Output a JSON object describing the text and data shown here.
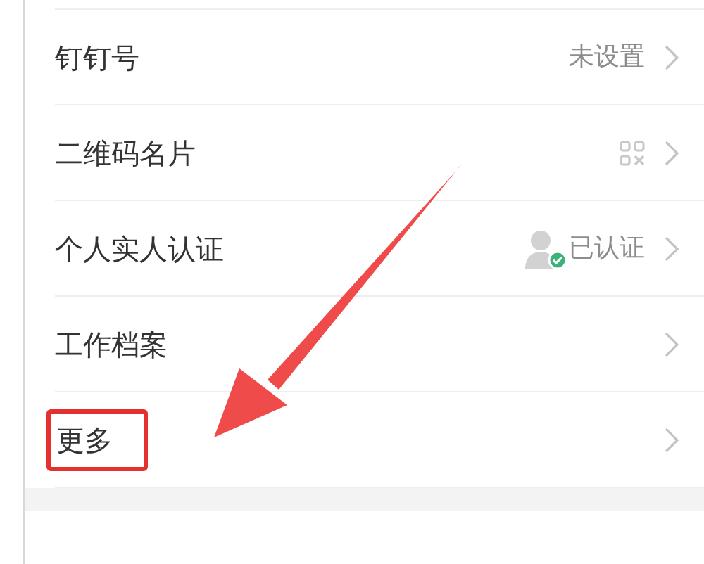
{
  "items": [
    {
      "label": "钉钉号",
      "kind": "text",
      "value": "未设置",
      "highlighted": false
    },
    {
      "label": "二维码名片",
      "kind": "qr",
      "highlighted": false
    },
    {
      "label": "个人实人认证",
      "kind": "verified",
      "value": "已认证",
      "highlighted": false
    },
    {
      "label": "工作档案",
      "kind": "plain",
      "highlighted": false
    },
    {
      "label": "更多",
      "kind": "plain",
      "highlighted": true
    }
  ],
  "pointer_arrow": true
}
